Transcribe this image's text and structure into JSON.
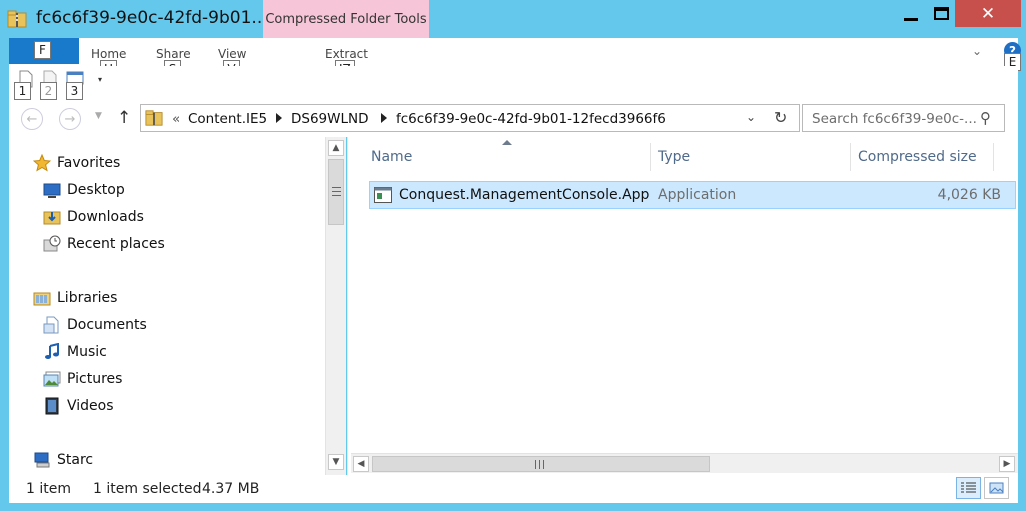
{
  "window": {
    "title": "fc6c6f39-9e0c-42fd-9b01...",
    "context_tab": "Compressed Folder Tools",
    "close_glyph": "✕"
  },
  "ribbon": {
    "file_keytip": "F",
    "tabs": [
      {
        "label": "Home",
        "keytip": "H"
      },
      {
        "label": "Share",
        "keytip": "S"
      },
      {
        "label": "View",
        "keytip": "V"
      },
      {
        "label": "Extract",
        "keytip": "JZ"
      }
    ],
    "expand_keytip": "E",
    "help_glyph": "?"
  },
  "quick_access": {
    "keytips": [
      "1",
      "2",
      "3"
    ]
  },
  "address": {
    "prefix": "«",
    "crumbs": [
      "Content.IE5",
      "DS69WLND",
      "fc6c6f39-9e0c-42fd-9b01-12fecd3966f6"
    ],
    "search_placeholder": "Search fc6c6f39-9e0c-..."
  },
  "nav_pane": {
    "groups": [
      {
        "label": "Favorites",
        "icon": "star-icon",
        "children": [
          {
            "label": "Desktop",
            "icon": "desktop-icon"
          },
          {
            "label": "Downloads",
            "icon": "downloads-folder-icon"
          },
          {
            "label": "Recent places",
            "icon": "recent-places-icon"
          }
        ]
      },
      {
        "label": "Libraries",
        "icon": "libraries-icon",
        "children": [
          {
            "label": "Documents",
            "icon": "documents-icon"
          },
          {
            "label": "Music",
            "icon": "music-icon"
          },
          {
            "label": "Pictures",
            "icon": "pictures-icon"
          },
          {
            "label": "Videos",
            "icon": "videos-icon"
          }
        ]
      },
      {
        "label": "Starc",
        "icon": "network-computer-icon",
        "children": []
      }
    ]
  },
  "file_list": {
    "columns": [
      "Name",
      "Type",
      "Compressed size"
    ],
    "rows": [
      {
        "name": "Conquest.ManagementConsole.App",
        "type": "Application",
        "size": "4,026 KB",
        "selected": true
      }
    ]
  },
  "status": {
    "item_count": "1 item",
    "selection": "1 item selected",
    "selection_size": "4.37 MB"
  },
  "colors": {
    "window_frame": "#63c8ec",
    "context_tab": "#f6c6d8",
    "file_tab": "#1979ca",
    "close_button": "#c7504c",
    "selection": "#cce8ff",
    "column_header_text": "#4f6a8a"
  }
}
